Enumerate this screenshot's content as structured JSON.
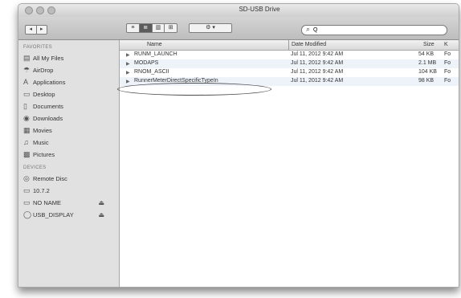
{
  "window": {
    "title": "SD-USB Drive"
  },
  "toolbar": {
    "back": "◂",
    "forward": "▸",
    "views": [
      "≡",
      "≣",
      "▥",
      "⊞"
    ],
    "action": "⚙ ▾",
    "search_value": "Q"
  },
  "sidebar": {
    "sections": [
      {
        "heading": "FAVORITES",
        "items": [
          {
            "label": "All My Files",
            "icon": "▤"
          },
          {
            "label": "AirDrop",
            "icon": "☂"
          },
          {
            "label": "Applications",
            "icon": "A"
          },
          {
            "label": "Desktop",
            "icon": "▭"
          },
          {
            "label": "Documents",
            "icon": "▯"
          },
          {
            "label": "Downloads",
            "icon": "◉"
          },
          {
            "label": "Movies",
            "icon": "▦"
          },
          {
            "label": "Music",
            "icon": "♫"
          },
          {
            "label": "Pictures",
            "icon": "▩"
          }
        ]
      },
      {
        "heading": "DEVICES",
        "items": [
          {
            "label": "Remote Disc",
            "icon": "◎"
          },
          {
            "label": "10.7.2",
            "icon": "▭"
          },
          {
            "label": "NO NAME",
            "icon": "▭",
            "eject": "⏏"
          },
          {
            "label": "USB_DISPLAY",
            "icon": "◯",
            "eject": "⏏"
          }
        ]
      }
    ]
  },
  "columns": {
    "name": "Name",
    "date": "Date Modified",
    "size": "Size",
    "kind": "K"
  },
  "files": [
    {
      "name": "RUNM_LAUNCH",
      "date": "Jul 11, 2012 9:42 AM",
      "size": "54 KB",
      "kind": "Fo"
    },
    {
      "name": "MODAPS",
      "date": "Jul 11, 2012 9:42 AM",
      "size": "2.1 MB",
      "kind": "Fo"
    },
    {
      "name": "RNOM_ASCII",
      "date": "Jul 11, 2012 9:42 AM",
      "size": "104 KB",
      "kind": "Fo"
    },
    {
      "name": "RunnerMeterDirectSpecificTypeIn",
      "date": "Jul 11, 2012 9:42 AM",
      "size": "98 KB",
      "kind": "Fo"
    }
  ]
}
